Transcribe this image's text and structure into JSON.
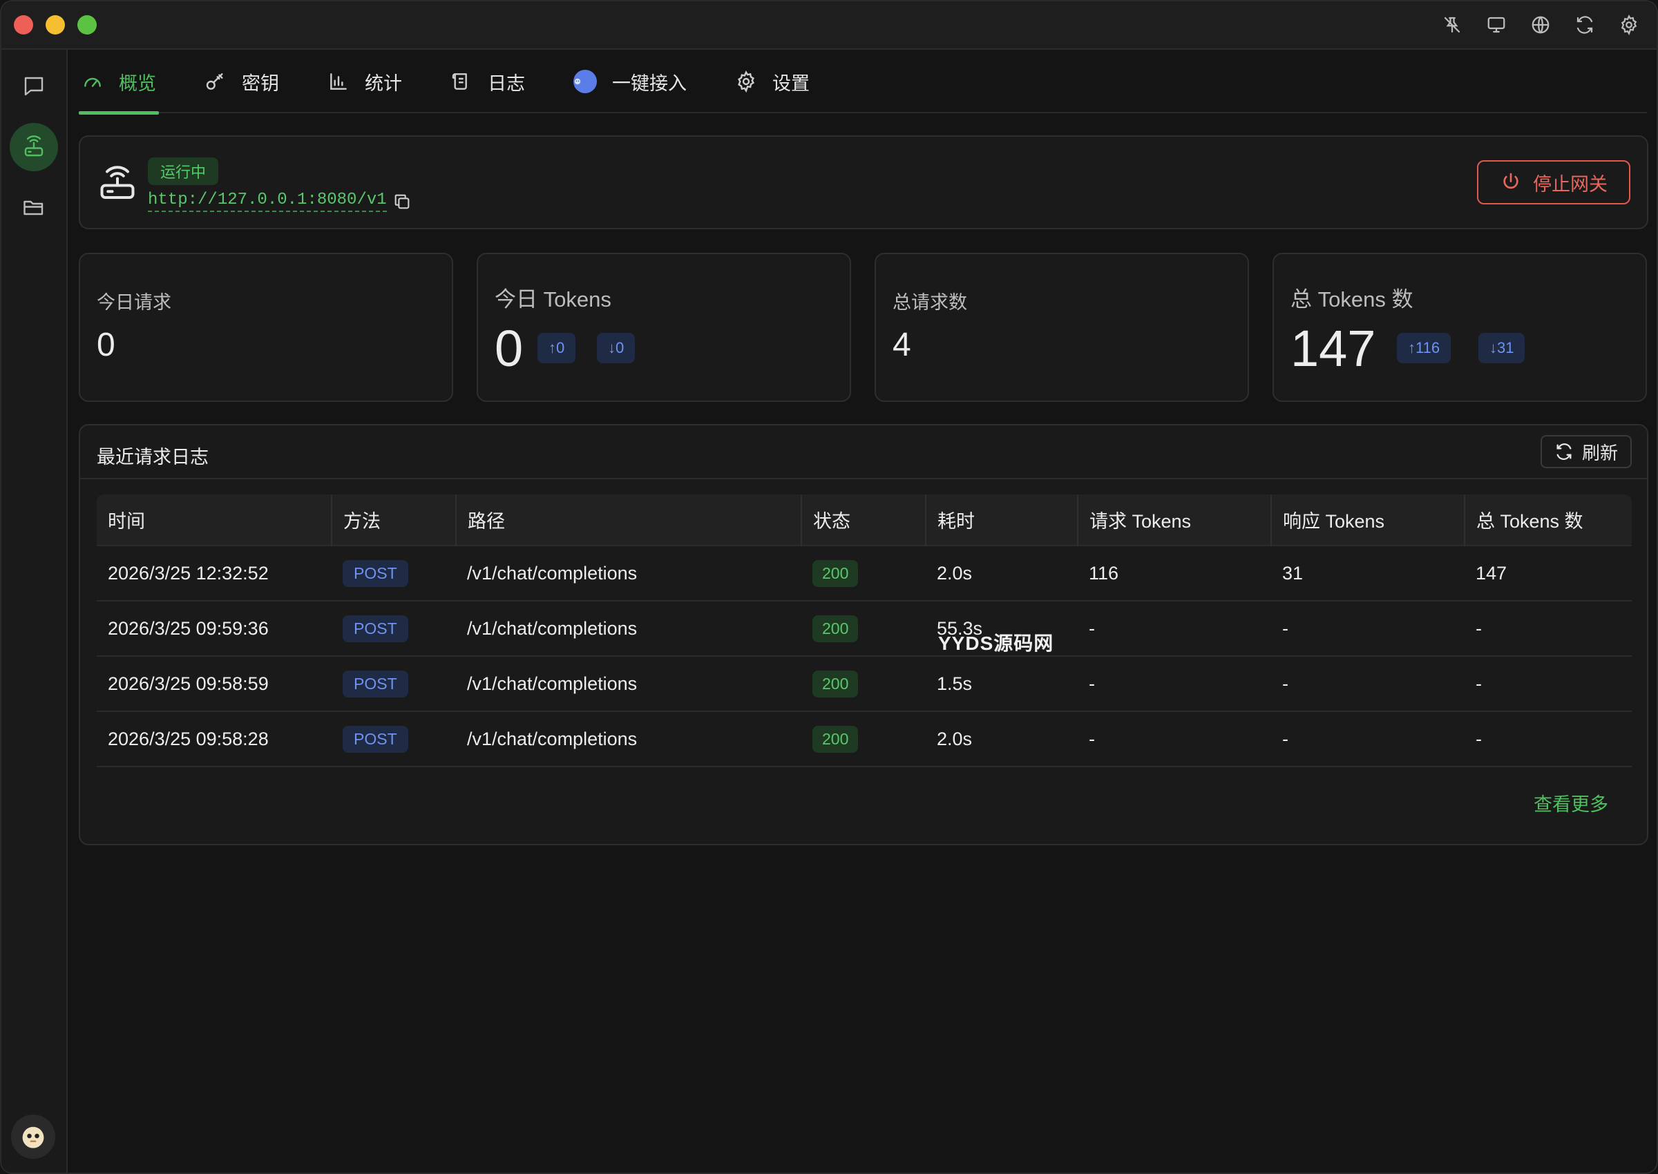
{
  "tabs": [
    {
      "label": "概览",
      "icon": "gauge-icon"
    },
    {
      "label": "密钥",
      "icon": "key-icon"
    },
    {
      "label": "统计",
      "icon": "bar-chart-icon"
    },
    {
      "label": "日志",
      "icon": "scroll-icon"
    },
    {
      "label": "一键接入",
      "icon": "app-emoji-icon"
    },
    {
      "label": "设置",
      "icon": "gear-icon"
    }
  ],
  "active_tab": "概览",
  "gateway": {
    "status": "运行中",
    "url": "http://127.0.0.1:8080/v1",
    "stop_label": "停止网关"
  },
  "stats": {
    "today_requests": {
      "label": "今日请求",
      "value": "0"
    },
    "today_tokens": {
      "label": "今日 Tokens",
      "value": "0",
      "up": "↑0",
      "down": "↓0"
    },
    "total_requests": {
      "label": "总请求数",
      "value": "4"
    },
    "total_tokens": {
      "label": "总 Tokens 数",
      "value": "147",
      "up": "↑116",
      "down": "↓31"
    }
  },
  "logs": {
    "title": "最近请求日志",
    "refresh_label": "刷新",
    "more_label": "查看更多",
    "columns": [
      "时间",
      "方法",
      "路径",
      "状态",
      "耗时",
      "请求 Tokens",
      "响应 Tokens",
      "总 Tokens 数"
    ],
    "rows": [
      {
        "time": "2026/3/25 12:32:52",
        "method": "POST",
        "path": "/v1/chat/completions",
        "status": "200",
        "duration": "2.0s",
        "req": "116",
        "resp": "31",
        "total": "147"
      },
      {
        "time": "2026/3/25 09:59:36",
        "method": "POST",
        "path": "/v1/chat/completions",
        "status": "200",
        "duration": "55.3s",
        "req": "-",
        "resp": "-",
        "total": "-"
      },
      {
        "time": "2026/3/25 09:58:59",
        "method": "POST",
        "path": "/v1/chat/completions",
        "status": "200",
        "duration": "1.5s",
        "req": "-",
        "resp": "-",
        "total": "-"
      },
      {
        "time": "2026/3/25 09:58:28",
        "method": "POST",
        "path": "/v1/chat/completions",
        "status": "200",
        "duration": "2.0s",
        "req": "-",
        "resp": "-",
        "total": "-"
      }
    ]
  },
  "watermark": "YYDS源码网",
  "colors": {
    "accent": "#4fbf5f",
    "danger": "#e2584f",
    "info": "#6f93f0",
    "background": "#141414"
  }
}
